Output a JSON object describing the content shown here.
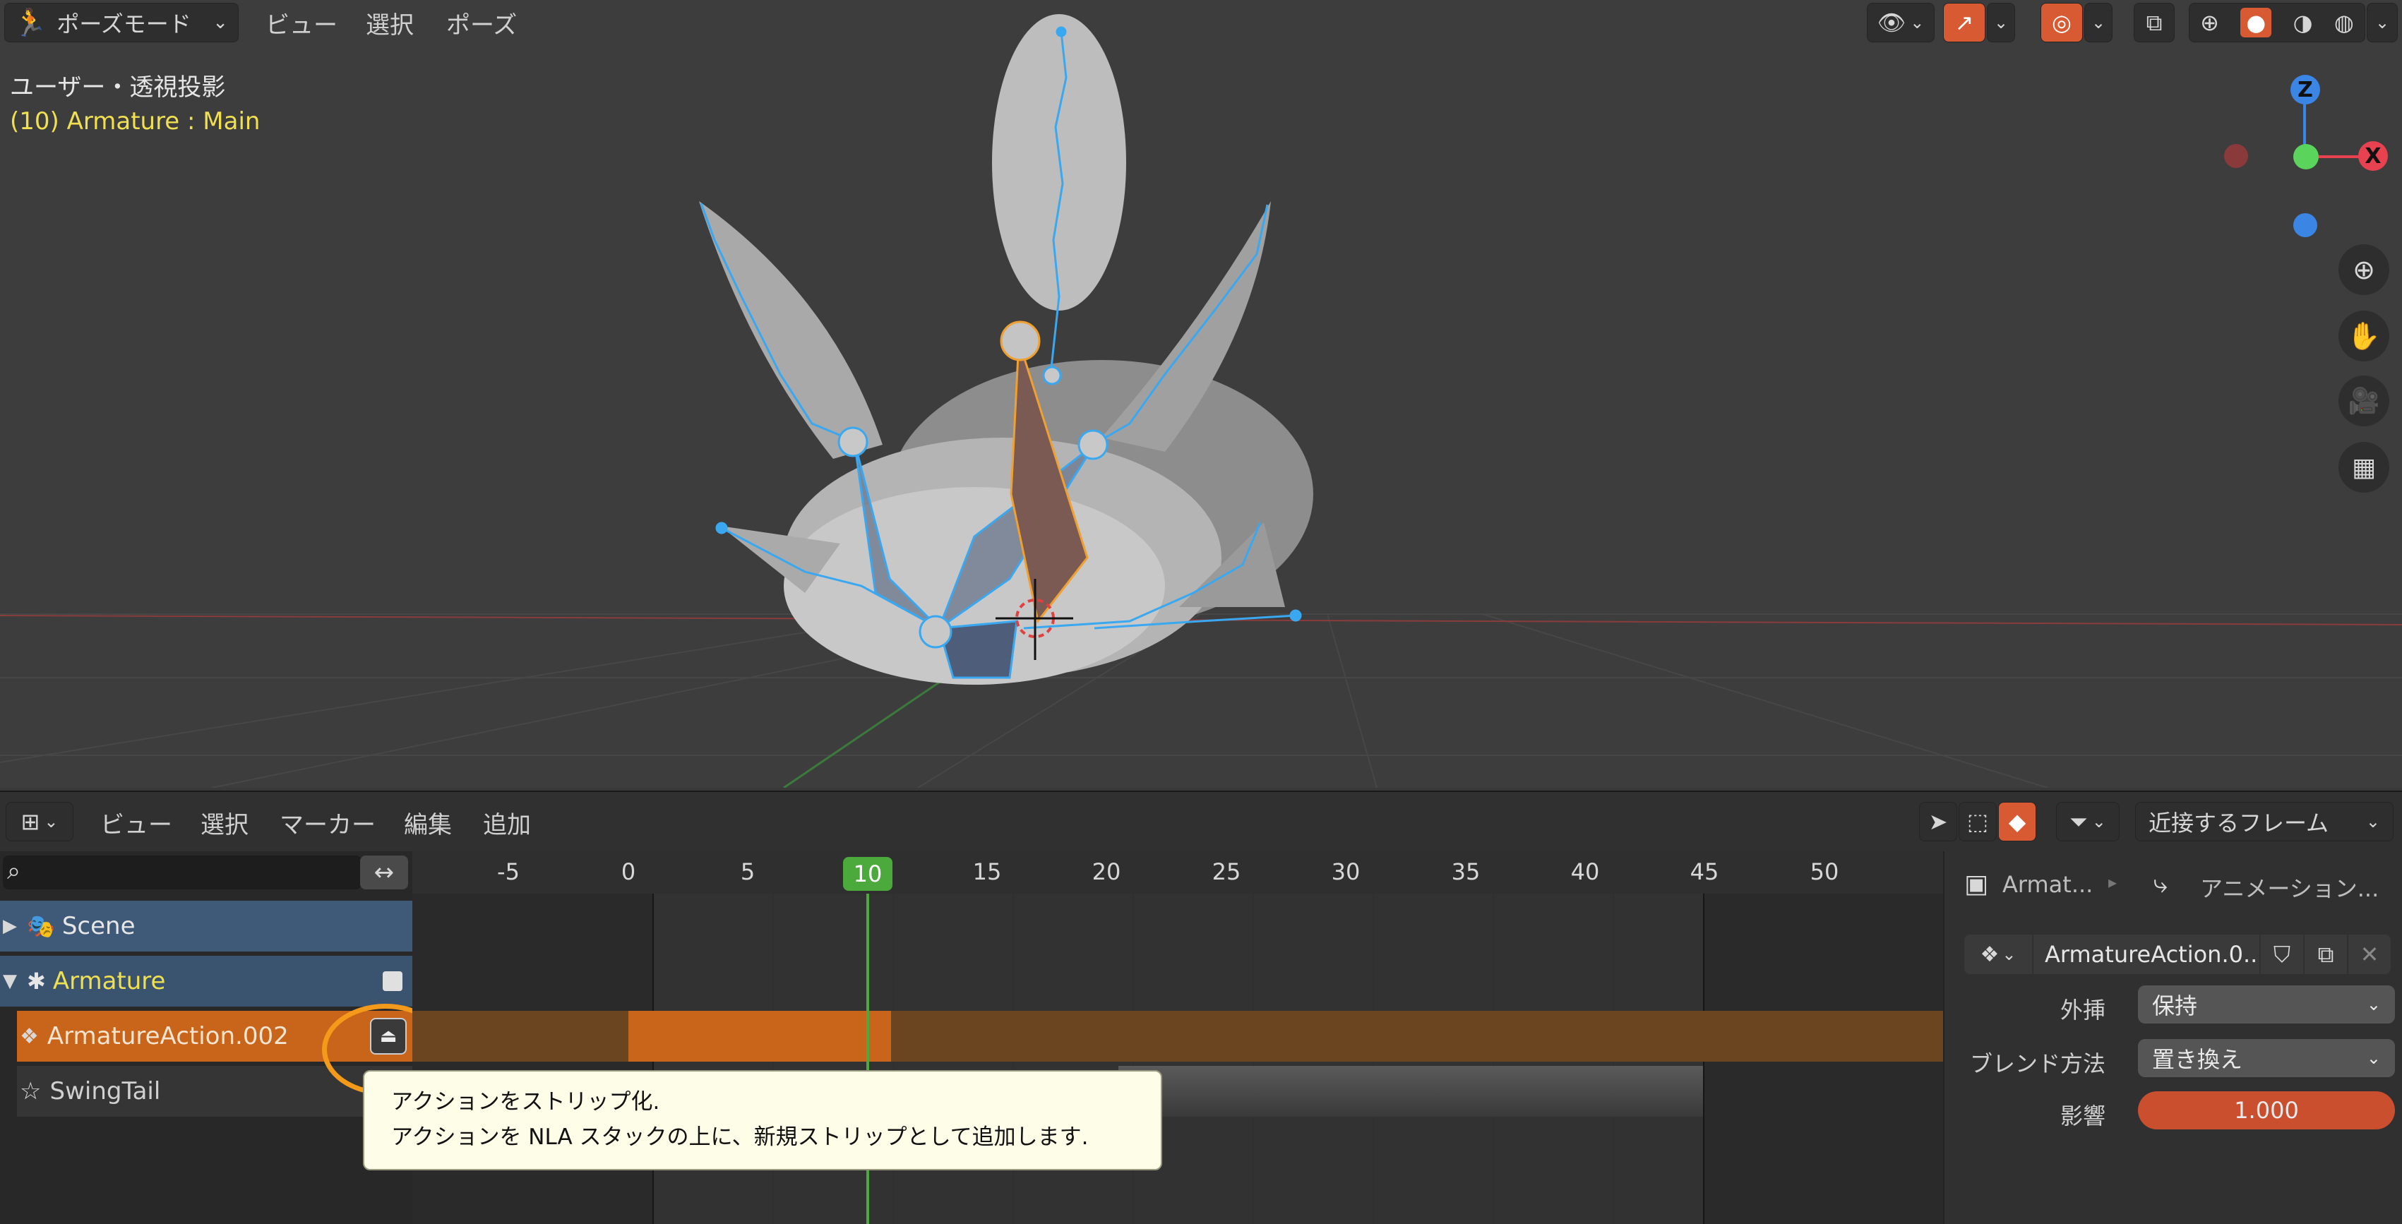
{
  "viewport": {
    "mode_label": "ポーズモード",
    "menus": [
      "ビュー",
      "選択",
      "ポーズ"
    ],
    "view_title": "ユーザー・透視投影",
    "object_info": "(10) Armature : Main",
    "gizmo": {
      "x": "X",
      "y": "Y",
      "z": "Z"
    },
    "colors": {
      "x_axis": "#e8414f",
      "y_axis": "#5bd45b",
      "z_axis": "#3b85e4",
      "bone": "#3aa8f0",
      "active_bone": "#f0a030"
    }
  },
  "dopesheet": {
    "menus": [
      "ビュー",
      "選択",
      "マーカー",
      "編集",
      "追加"
    ],
    "snap_label": "近接するフレーム",
    "search_placeholder": "",
    "channels": [
      {
        "label": "Scene"
      },
      {
        "label": "Armature"
      },
      {
        "label": "ArmatureAction.002"
      },
      {
        "label": "SwingTail"
      }
    ],
    "ruler_ticks": [
      "-5",
      "0",
      "5",
      "10",
      "15",
      "20",
      "25",
      "30",
      "35",
      "40",
      "45",
      "50"
    ],
    "current_frame": "10",
    "sidebar": {
      "breadcrumb_object": "Armat...",
      "breadcrumb_data": "アニメーション...",
      "action_name": "ArmatureAction.0...",
      "extrapolation_label": "外挿",
      "extrapolation_value": "保持",
      "blend_label": "ブレンド方法",
      "blend_value": "置き換え",
      "influence_label": "影響",
      "influence_value": "1.000"
    }
  },
  "tooltip": {
    "title": "アクションをストリップ化.",
    "description": "アクションを NLA スタックの上に、新規ストリップとして追加します."
  }
}
